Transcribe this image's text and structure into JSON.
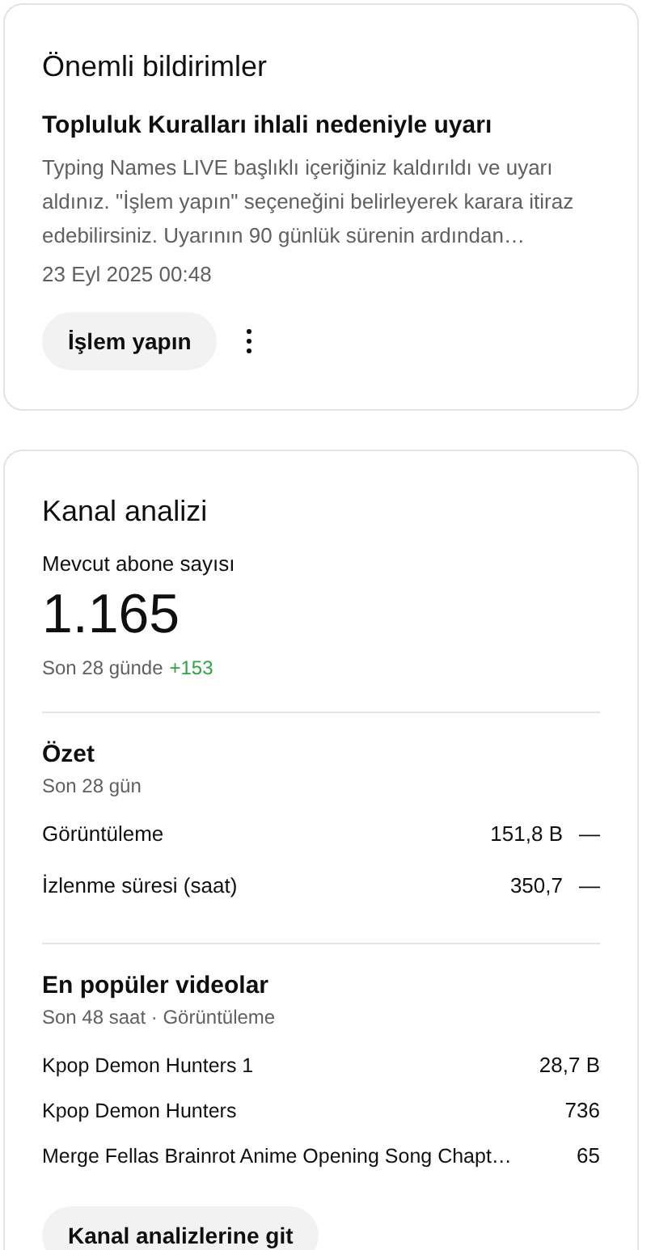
{
  "notifications": {
    "title": "Önemli bildirimler",
    "item": {
      "title": "Topluluk Kuralları ihlali nedeniyle uyarı",
      "body": "Typing Names LIVE başlıklı içeriğiniz kaldırıldı ve uyarı aldınız. \"İşlem yapın\" seçeneğini belirleyerek karara itiraz edebilirsiniz. Uyarının 90 günlük sürenin ardından…",
      "date": "23 Eyl 2025 00:48",
      "action": "İşlem yapın"
    }
  },
  "analytics": {
    "title": "Kanal analizi",
    "subscribers": {
      "label": "Mevcut abone sayısı",
      "value": "1.165",
      "period": "Son 28 günde",
      "change": "+153"
    },
    "summary": {
      "title": "Özet",
      "period": "Son 28 gün",
      "rows": [
        {
          "label": "Görüntüleme",
          "value": "151,8 B",
          "trend": "—"
        },
        {
          "label": "İzlenme süresi (saat)",
          "value": "350,7",
          "trend": "—"
        }
      ]
    },
    "top_videos": {
      "title": "En popüler videolar",
      "period": "Son 48 saat · Görüntüleme",
      "rows": [
        {
          "title": "Kpop Demon Hunters 1",
          "value": "28,7 B"
        },
        {
          "title": "Kpop Demon Hunters",
          "value": "736"
        },
        {
          "title": "Merge Fellas Brainrot Anime Opening Song Chapt…",
          "value": "65"
        }
      ]
    },
    "action": "Kanal analizlerine git"
  }
}
